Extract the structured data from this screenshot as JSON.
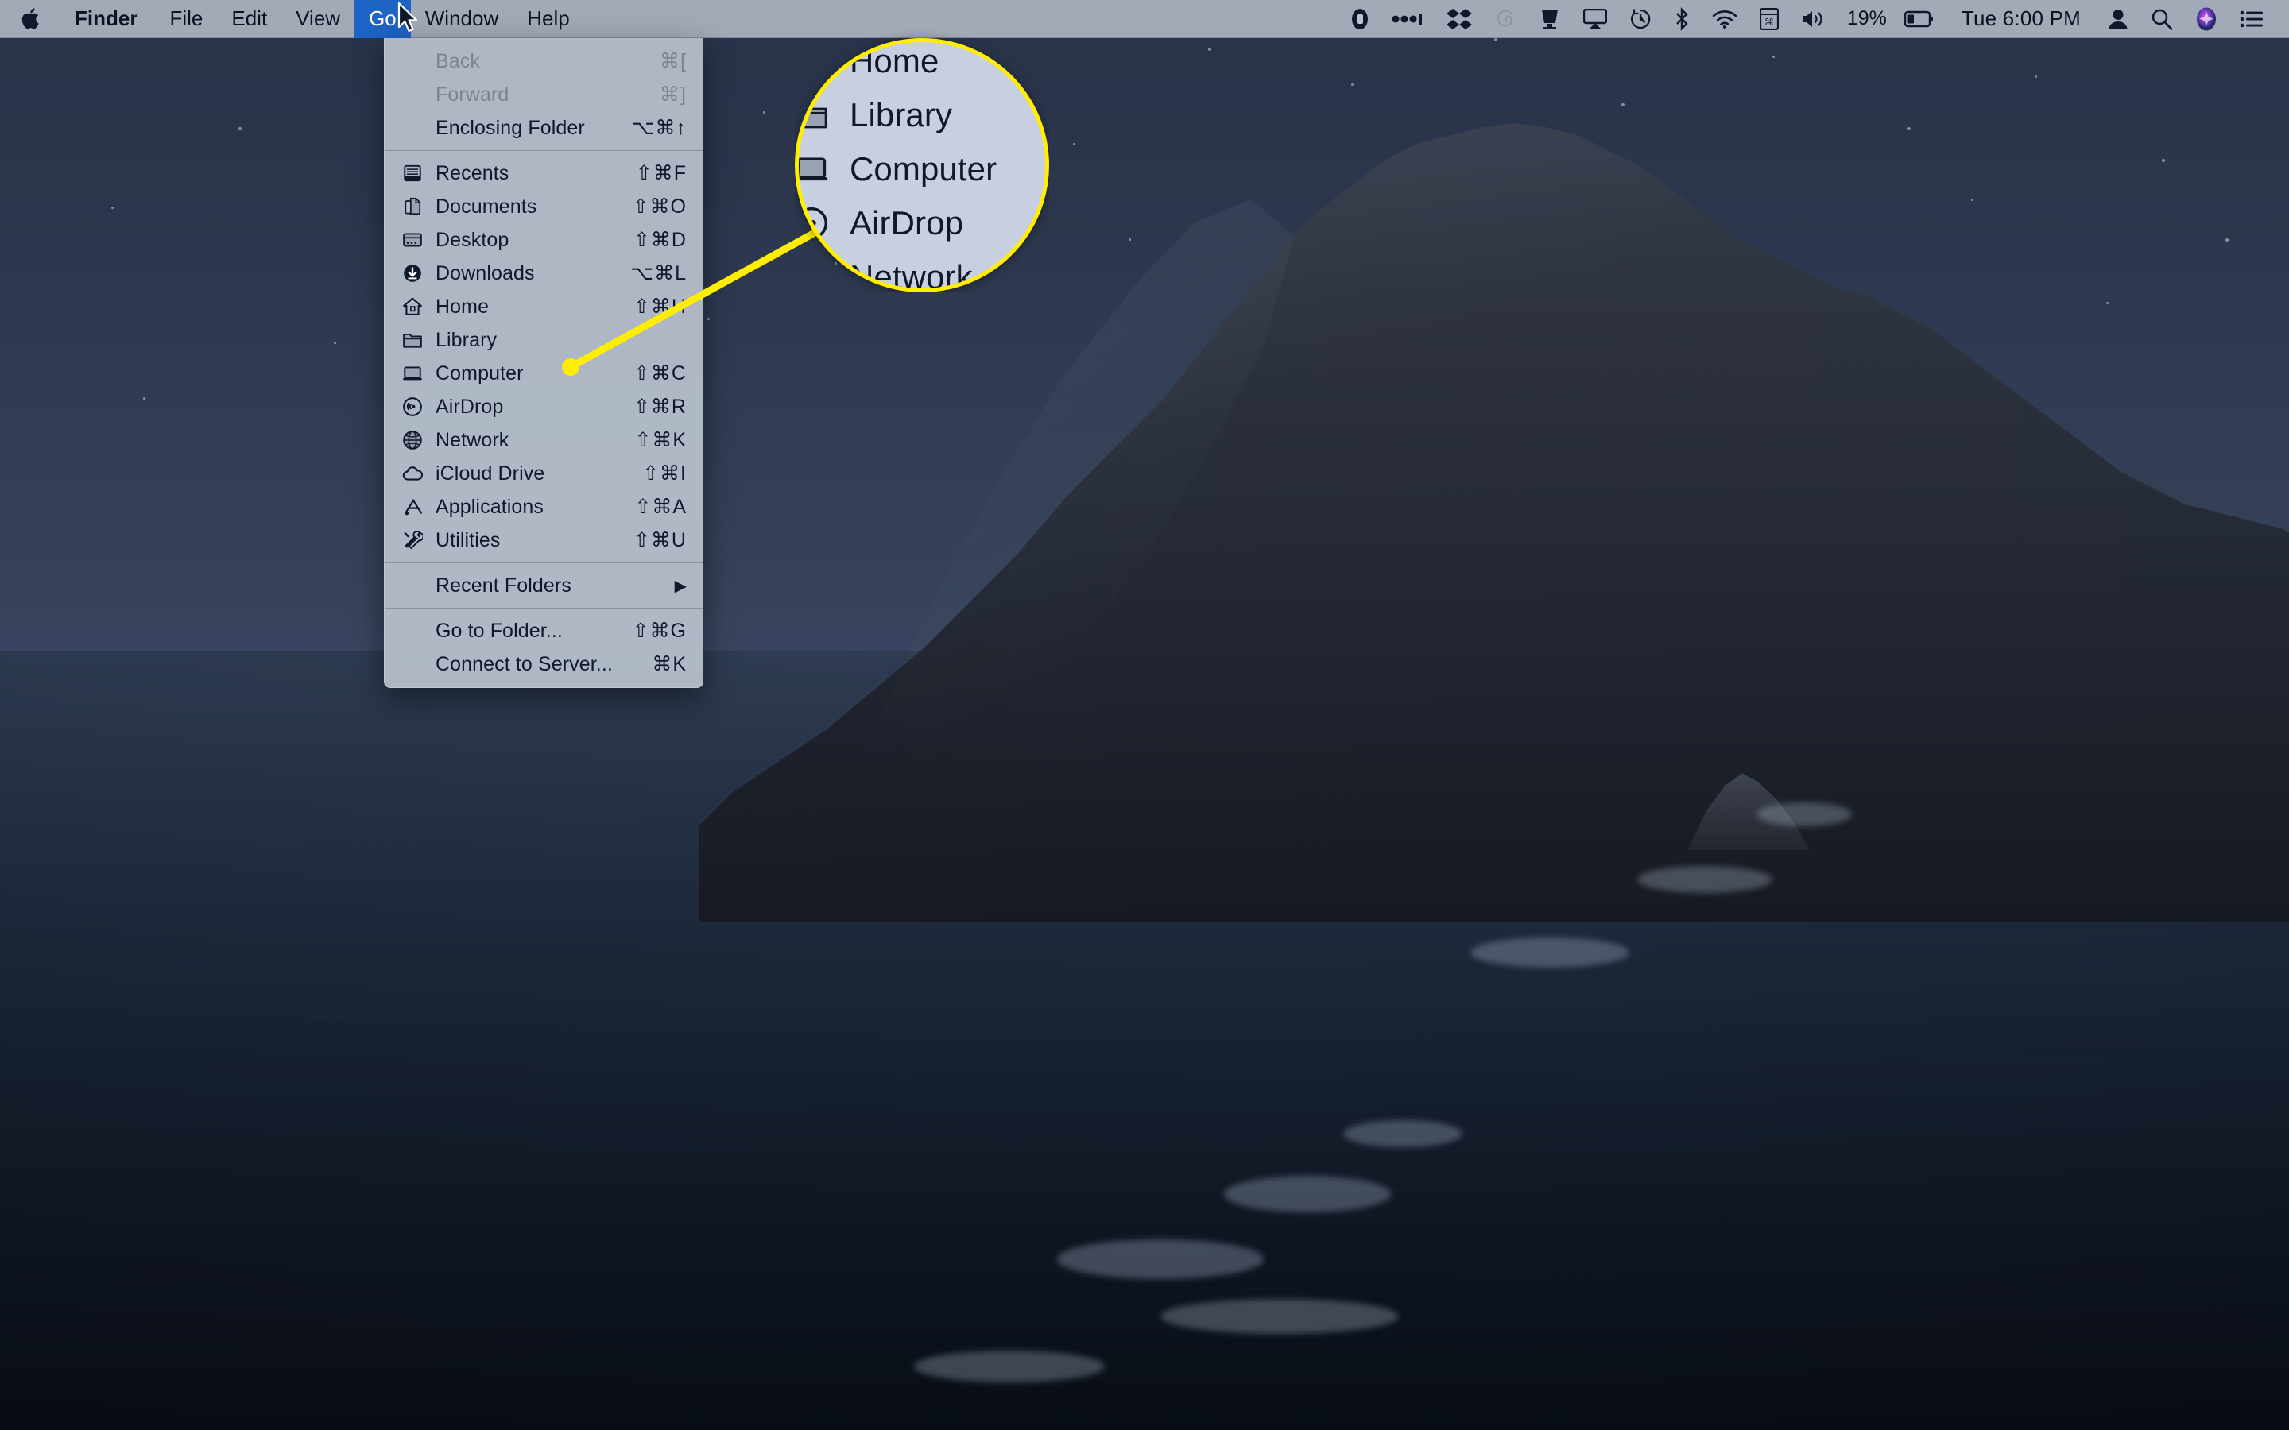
{
  "menubar": {
    "apple_icon": "apple-logo-icon",
    "app_name": "Finder",
    "items": [
      {
        "label": "File",
        "active": false
      },
      {
        "label": "Edit",
        "active": false
      },
      {
        "label": "View",
        "active": false
      },
      {
        "label": "Go",
        "active": true
      },
      {
        "label": "Window",
        "active": false
      },
      {
        "label": "Help",
        "active": false
      }
    ],
    "status_icons": [
      "onedrive-icon",
      "flux-icon",
      "dropbox-icon",
      "creative-cloud-icon",
      "display-icon",
      "airplay-icon",
      "time-machine-icon",
      "bluetooth-icon",
      "wifi-icon",
      "keyboard-input-icon",
      "volume-icon"
    ],
    "battery_percent": "19%",
    "battery_icon": "battery-icon",
    "clock": "Tue 6:00 PM",
    "user_icon": "user-account-icon",
    "spotlight_icon": "search-icon",
    "siri_icon": "siri-icon",
    "control_center_icon": "notification-center-icon"
  },
  "go_menu": {
    "groups": [
      {
        "items": [
          {
            "label": "Back",
            "shortcut": "⌘[",
            "icon": null,
            "disabled": true
          },
          {
            "label": "Forward",
            "shortcut": "⌘]",
            "icon": null,
            "disabled": true
          },
          {
            "label": "Enclosing Folder",
            "shortcut": "⌥⌘↑",
            "icon": null,
            "disabled": false
          }
        ]
      },
      {
        "items": [
          {
            "label": "Recents",
            "shortcut": "⇧⌘F",
            "icon": "recents-icon",
            "disabled": false
          },
          {
            "label": "Documents",
            "shortcut": "⇧⌘O",
            "icon": "documents-icon",
            "disabled": false
          },
          {
            "label": "Desktop",
            "shortcut": "⇧⌘D",
            "icon": "desktop-icon",
            "disabled": false
          },
          {
            "label": "Downloads",
            "shortcut": "⌥⌘L",
            "icon": "downloads-icon",
            "disabled": false
          },
          {
            "label": "Home",
            "shortcut": "⇧⌘H",
            "icon": "home-icon",
            "disabled": false
          },
          {
            "label": "Library",
            "shortcut": "",
            "icon": "folder-icon",
            "disabled": false
          },
          {
            "label": "Computer",
            "shortcut": "⇧⌘C",
            "icon": "computer-icon",
            "disabled": false
          },
          {
            "label": "AirDrop",
            "shortcut": "⇧⌘R",
            "icon": "airdrop-icon",
            "disabled": false
          },
          {
            "label": "Network",
            "shortcut": "⇧⌘K",
            "icon": "network-icon",
            "disabled": false
          },
          {
            "label": "iCloud Drive",
            "shortcut": "⇧⌘I",
            "icon": "icloud-icon",
            "disabled": false
          },
          {
            "label": "Applications",
            "shortcut": "⇧⌘A",
            "icon": "applications-icon",
            "disabled": false
          },
          {
            "label": "Utilities",
            "shortcut": "⇧⌘U",
            "icon": "utilities-icon",
            "disabled": false
          }
        ]
      },
      {
        "items": [
          {
            "label": "Recent Folders",
            "shortcut": "",
            "icon": null,
            "disabled": false,
            "submenu": true
          }
        ]
      },
      {
        "items": [
          {
            "label": "Go to Folder...",
            "shortcut": "⇧⌘G",
            "icon": null,
            "disabled": false
          },
          {
            "label": "Connect to Server...",
            "shortcut": "⌘K",
            "icon": null,
            "disabled": false
          }
        ]
      }
    ]
  },
  "callout": {
    "accent_color": "#ffee00",
    "target_item": "Computer",
    "magnified_items": [
      {
        "label": "Home",
        "icon": "home-icon"
      },
      {
        "label": "Library",
        "icon": "folder-icon"
      },
      {
        "label": "Computer",
        "icon": "computer-icon"
      },
      {
        "label": "AirDrop",
        "icon": "airdrop-icon"
      },
      {
        "label": "Network",
        "icon": "network-icon"
      }
    ]
  },
  "desktop": {
    "wallpaper_name": "Catalina Night"
  }
}
